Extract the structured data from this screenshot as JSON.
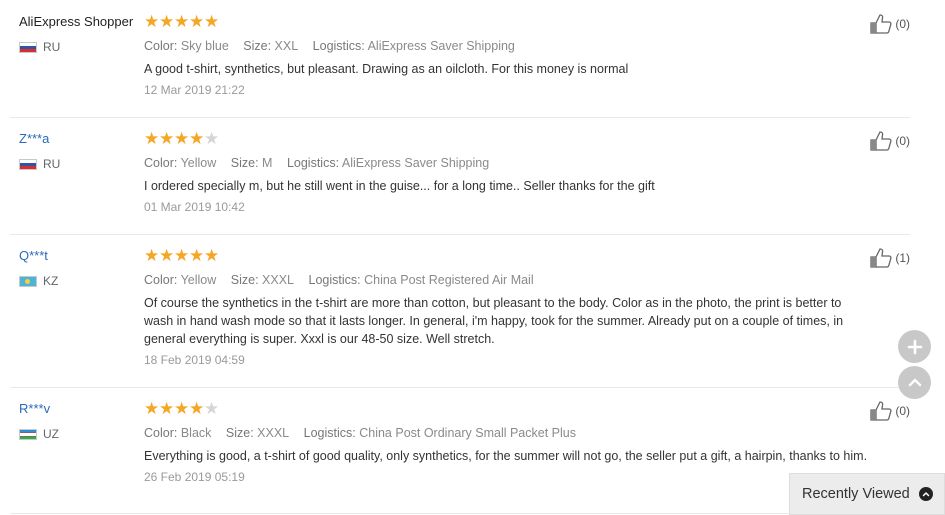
{
  "reviews": [
    {
      "user": "AliExpress Shopper",
      "country": "RU",
      "flag": "flag-ru-icon",
      "stars": 5,
      "color_label": "Color:",
      "color": "Sky blue",
      "size_label": "Size:",
      "size": "XXL",
      "logistics_label": "Logistics:",
      "logistics": "AliExpress Saver Shipping",
      "text": "A good t-shirt, synthetics, but pleasant. Drawing as an oilcloth. For this money is normal",
      "date": "12 Mar 2019 21:22",
      "likes": "(0)"
    },
    {
      "user": "Z***a",
      "country": "RU",
      "flag": "flag-ru-icon",
      "stars": 4,
      "color_label": "Color:",
      "color": "Yellow",
      "size_label": "Size:",
      "size": "M",
      "logistics_label": "Logistics:",
      "logistics": "AliExpress Saver Shipping",
      "text": "I ordered specially m, but he still went in the guise... for a long time.. Seller thanks for the gift",
      "date": "01 Mar 2019 10:42",
      "likes": "(0)"
    },
    {
      "user": "Q***t",
      "country": "KZ",
      "flag": "flag-kz-icon",
      "stars": 5,
      "color_label": "Color:",
      "color": "Yellow",
      "size_label": "Size:",
      "size": "XXXL",
      "logistics_label": "Logistics:",
      "logistics": "China Post Registered Air Mail",
      "text": "Of course the synthetics in the t-shirt are more than cotton, but pleasant to the body. Color as in the photo, the print is better to wash in hand wash mode so that it lasts longer. In general, i'm happy, took for the summer. Already put on a couple of times, in general everything is super. Xxxl is our 48-50 size. Well stretch.",
      "date": "18 Feb 2019 04:59",
      "likes": "(1)"
    },
    {
      "user": "R***v",
      "country": "UZ",
      "flag": "flag-uz-icon",
      "stars": 4,
      "color_label": "Color:",
      "color": "Black",
      "size_label": "Size:",
      "size": "XXXL",
      "logistics_label": "Logistics:",
      "logistics": "China Post Ordinary Small Packet Plus",
      "text": "Everything is good, a t-shirt of good quality, only synthetics, for the summer will not go, the seller put a gift, a hairpin, thanks to him.",
      "date": "26 Feb 2019 05:19",
      "likes": "(0)"
    }
  ],
  "recently_viewed": "Recently Viewed",
  "colors": {
    "star": "#f5a623",
    "star_empty": "#d5d5d5",
    "masked_user": "#2a6ab8"
  }
}
